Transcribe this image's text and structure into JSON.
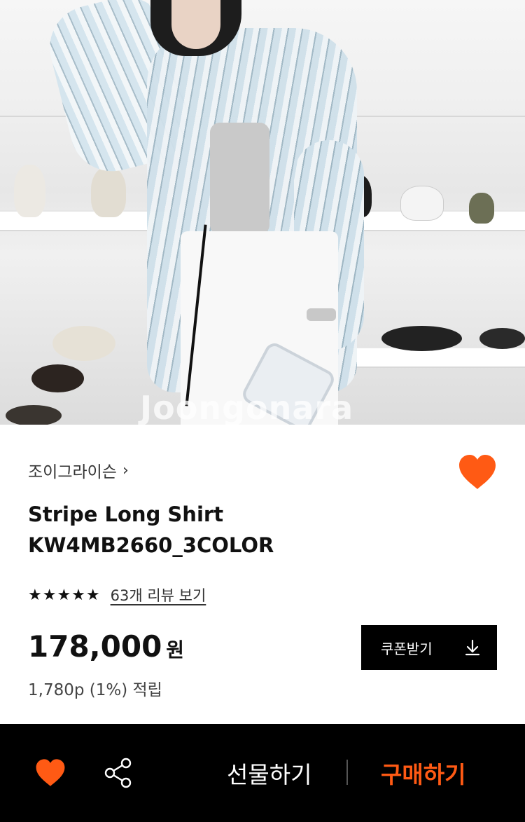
{
  "hero": {
    "watermark": "Joongonara"
  },
  "brand": {
    "name": "조이그라이슨",
    "chevron": "›"
  },
  "product": {
    "title_line1": "Stripe Long Shirt",
    "title_line2": "KW4MB2660_3COLOR"
  },
  "rating": {
    "stars": "★★★★★",
    "stars_value": 5,
    "review_link": "63개 리뷰 보기"
  },
  "price": {
    "amount": "178,000",
    "unit": "원",
    "points": "1,780p (1%) 적립"
  },
  "coupon": {
    "label": "쿠폰받기"
  },
  "bottom_bar": {
    "gift_label": "선물하기",
    "buy_label": "구매하기"
  },
  "colors": {
    "accent": "#ff5a14",
    "black": "#000000"
  },
  "icons": [
    "heart-icon",
    "chevron-right-icon",
    "download-icon",
    "share-icon"
  ]
}
